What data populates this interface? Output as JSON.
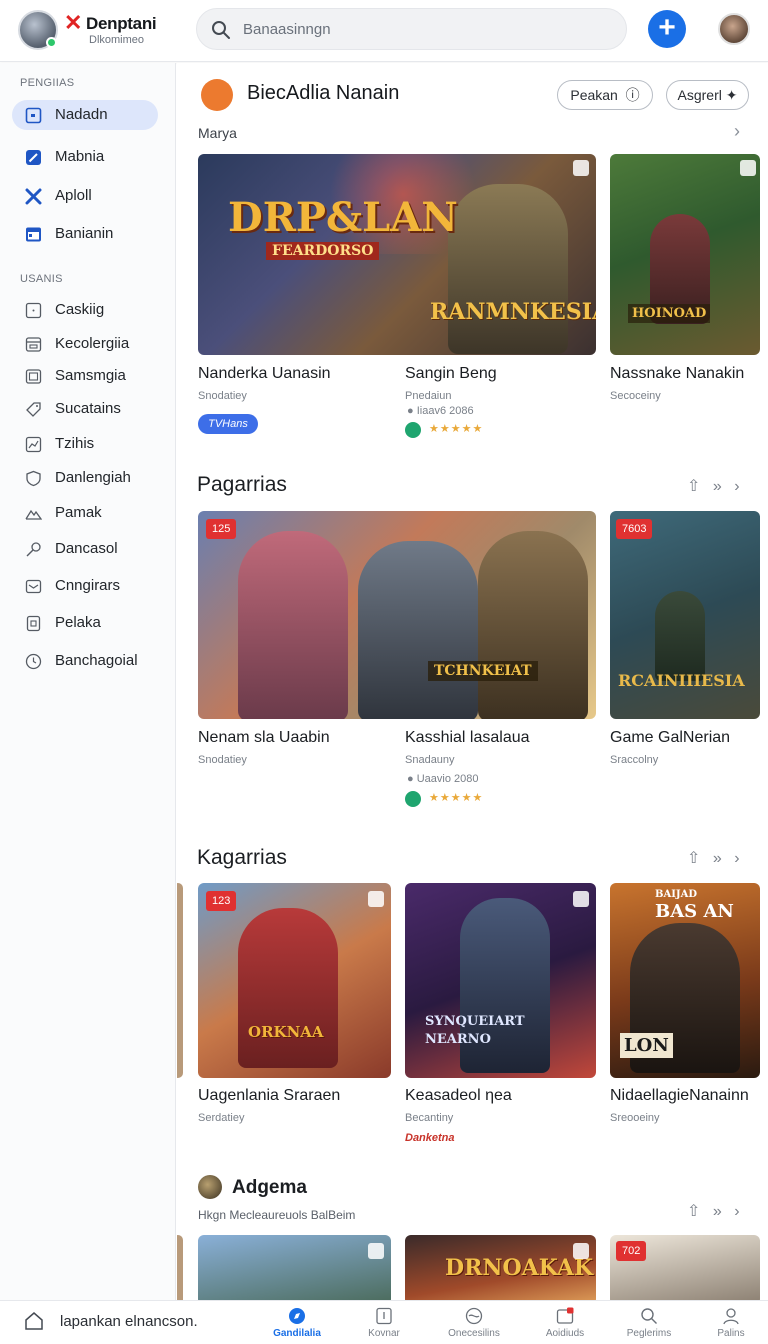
{
  "app": {
    "brand_name": "Denptani",
    "brand_sub": "Dlkomimeo",
    "search_placeholder": "Banaasinngn"
  },
  "sidebar": {
    "heading_1": "PENGIIAS",
    "primary_items": [
      {
        "label": "Nadadn",
        "icon": "square-icon",
        "active": true
      },
      {
        "label": "Mabnia",
        "icon": "pen-icon"
      },
      {
        "label": "Aploll",
        "icon": "x-icon"
      },
      {
        "label": "Banianin",
        "icon": "calendar-icon"
      }
    ],
    "heading_2": "USANIS",
    "secondary_items": [
      {
        "label": "Caskiig",
        "icon": "square-icon"
      },
      {
        "label": "Kecolergiia",
        "icon": "box-icon"
      },
      {
        "label": "Samsmgia",
        "icon": "image-icon"
      },
      {
        "label": "Sucatains",
        "icon": "tag-icon"
      },
      {
        "label": "Tzihis",
        "icon": "chart-icon"
      },
      {
        "label": "Danlengiah",
        "icon": "shield-icon"
      },
      {
        "label": "Pamak",
        "icon": "mountain-icon"
      },
      {
        "label": "Dancasol",
        "icon": "key-icon"
      },
      {
        "label": "Cnngirars",
        "icon": "mail-icon"
      },
      {
        "label": "Pelaka",
        "icon": "doc-icon"
      },
      {
        "label": "Banchagoial",
        "icon": "clock-icon"
      }
    ]
  },
  "header": {
    "title": "BiecAdlia Nanain",
    "pill_1": "Peakan",
    "pill_2": "Asgrerl",
    "sub_label": "Marya"
  },
  "section_1": {
    "cards": [
      {
        "title": "Nanderka Uanasin",
        "sub": "Snodatiey",
        "tag": "TVHans",
        "art_title": "DRP&LAN",
        "art_sub": "FEARDORSO",
        "art_logo": "RANMNKESIA"
      },
      {
        "title": "Sangin Beng",
        "sub": "Pnedaiun",
        "meta": "Iiaav6 2086",
        "stars": "★★★★★"
      },
      {
        "title": "Nassnake Nanakin",
        "sub": "Secoceiny",
        "art_logo": "HOINOAD"
      }
    ]
  },
  "section_2": {
    "title": "Pagarrias",
    "cards": [
      {
        "title": "Nenam sla Uaabin",
        "sub": "Snodatiey",
        "badge": "125",
        "art_logo": "TCHNKEIAT"
      },
      {
        "title": "Kasshial lasalaua",
        "sub": "Snadauny",
        "meta": "Uaavio 2080",
        "stars": "★★★★★"
      },
      {
        "title": "Game GalNerian",
        "sub": "Sraccolny",
        "badge": "7603",
        "art_logo": "RCAINIIIESIA"
      }
    ]
  },
  "section_3": {
    "title": "Kagarrias",
    "cards": [
      {
        "title": "Uagenlania Sraraen",
        "sub": "Serdatiey",
        "badge": "123",
        "art_logo": "ORKNAA"
      },
      {
        "title": "Keasadeol ηea",
        "sub": "Becantiny",
        "meta": "Danketna",
        "art_logo": "SYNQUEIART NEARNO"
      },
      {
        "title": "NidaellagieNanainn",
        "sub": "Sreooeiny",
        "art_logo": "BAS AN",
        "art_small": "BAIJAD",
        "art_box": "LON"
      }
    ]
  },
  "section_4": {
    "title": "Adgema",
    "subtitle": "Hkgn Mecleaureuols BalBeim",
    "card_badge": "702",
    "art_logo": "DRNOAKAK"
  },
  "bottom_bar": {
    "text": "lapankan elnancson.",
    "tabs": [
      {
        "label": "Gandilalia",
        "active": true
      },
      {
        "label": "Kovnar"
      },
      {
        "label": "Onecesilins"
      },
      {
        "label": "Aoidiuds"
      },
      {
        "label": "Peglerims"
      },
      {
        "label": "Palins"
      }
    ]
  },
  "colors": {
    "accent": "#1a6fe6",
    "danger": "#e03131",
    "sidebar_active": "#dde6fb"
  }
}
